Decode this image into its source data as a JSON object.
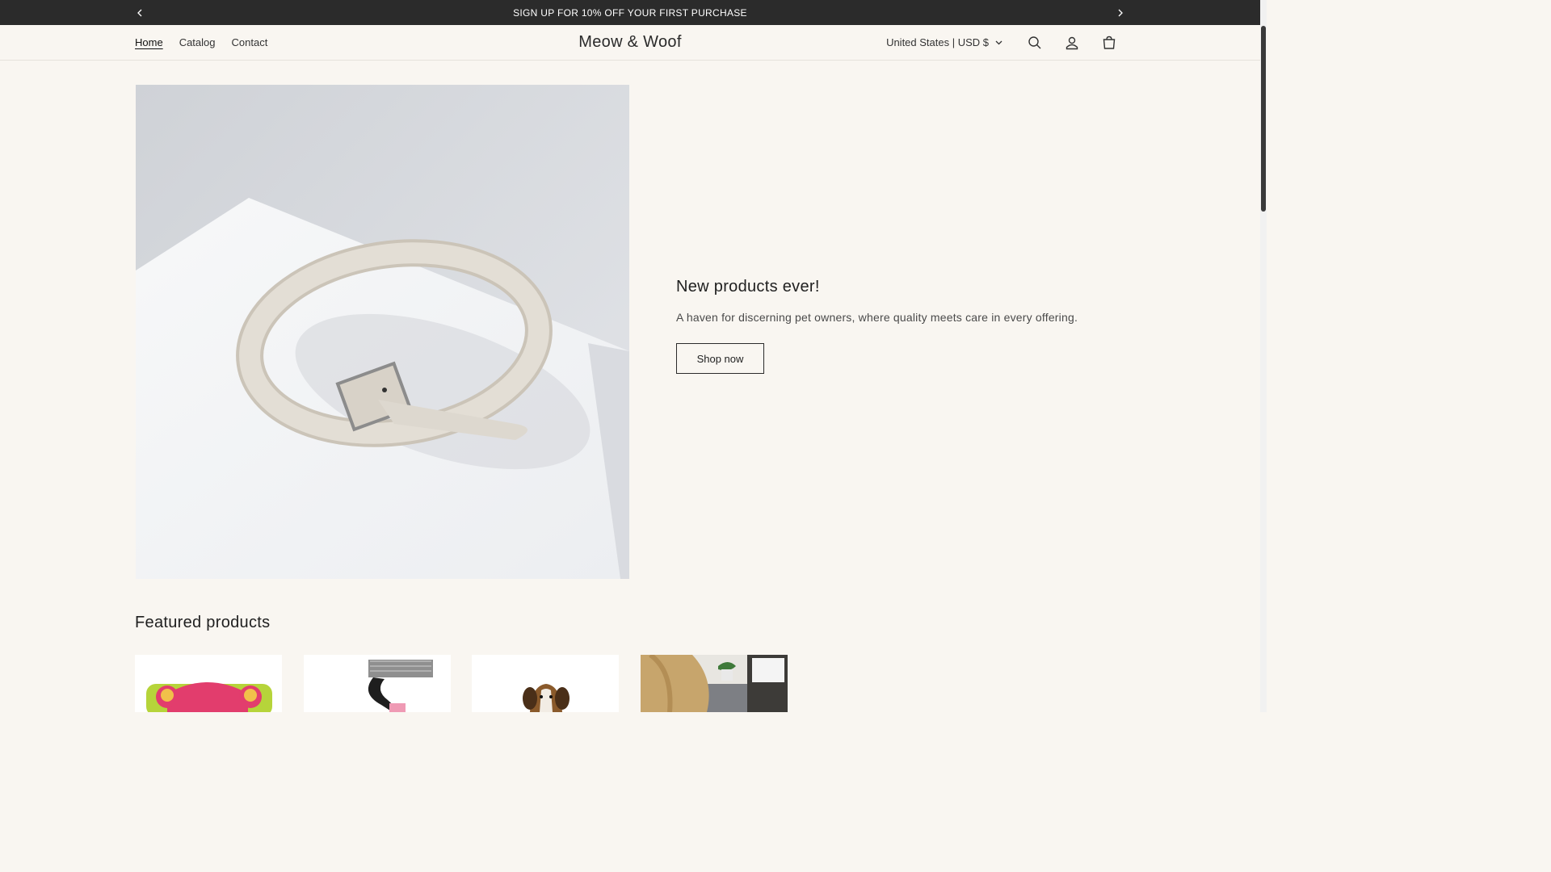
{
  "announcement": {
    "text": "SIGN UP FOR 10% OFF YOUR FIRST PURCHASE"
  },
  "header": {
    "logo": "Meow & Woof",
    "nav": [
      {
        "label": "Home",
        "active": true
      },
      {
        "label": "Catalog",
        "active": false
      },
      {
        "label": "Contact",
        "active": false
      }
    ],
    "country_selector": "United States | USD $"
  },
  "hero": {
    "title": "New products ever!",
    "subtitle": "A haven for discerning pet owners, where quality meets care in every offering.",
    "button": "Shop now"
  },
  "featured": {
    "title": "Featured products"
  },
  "icons": {
    "search": "search-icon",
    "account": "account-icon",
    "cart": "cart-icon"
  }
}
